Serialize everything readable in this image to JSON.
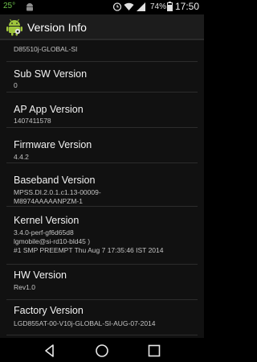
{
  "status_bar": {
    "temperature": "25°",
    "battery_percent": "74%",
    "time": "17:50",
    "icons": [
      "android-notification-icon",
      "alarm-icon",
      "wifi-icon",
      "signal-icon",
      "battery-icon"
    ]
  },
  "app_bar": {
    "title": "Version Info",
    "icon": "android-robot-icon"
  },
  "content": {
    "partial_top_value": "D85510j-GLOBAL-SI",
    "items": [
      {
        "title": "Sub SW Version",
        "value": "0"
      },
      {
        "title": "AP App Version",
        "value": "1407411578"
      },
      {
        "title": "Firmware Version",
        "value": "4.4.2"
      },
      {
        "title": "Baseband Version",
        "value_lines": [
          "MPSS.DI.2.0.1.c1.13-00009-",
          "M8974AAAAANPZM-1"
        ]
      },
      {
        "title": "Kernel Version",
        "value_lines": [
          "3.4.0-perf-gf6d65d8",
          "lgmobile@si-rd10-bld45 )",
          "#1 SMP PREEMPT Thu Aug 7 17:35:46 IST 2014"
        ]
      },
      {
        "title": "HW Version",
        "value": "Rev1.0"
      },
      {
        "title": "Factory Version",
        "value": "LGD855AT-00-V10j-GLOBAL-SI-AUG-07-2014"
      }
    ]
  },
  "nav_bar": {
    "buttons": [
      "back-icon",
      "home-icon",
      "recent-apps-icon"
    ]
  },
  "colors": {
    "app_bar_bg": "#1c1c1c",
    "content_bg": "#111111",
    "temperature_color": "#6cc04a"
  }
}
